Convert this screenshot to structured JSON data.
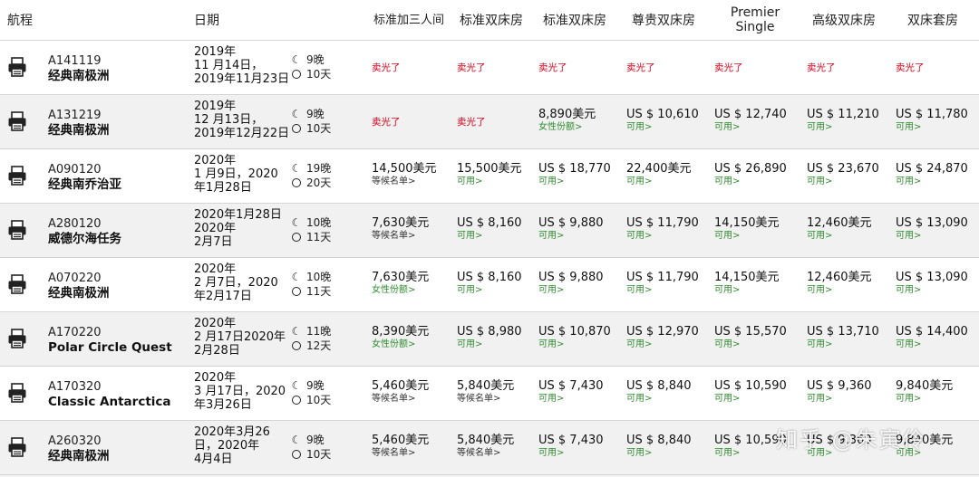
{
  "headers": {
    "route": "航程",
    "date": "日期",
    "cols": [
      "标准加三人间",
      "标准双床房",
      "标准双床房",
      "尊贵双床房",
      "Premier Single",
      "高级双床房",
      "双床套房"
    ]
  },
  "colors": {
    "sold": "#d0021b",
    "available": "#2e8b2e"
  },
  "icon": "printer-icon",
  "rows": [
    {
      "code": "A141119",
      "name": "经典南极洲",
      "date": [
        "2019年",
        "11 月14日，",
        "2019年11月23日"
      ],
      "nights": "9晚",
      "days": "10天",
      "prices": [
        {
          "price": "",
          "status": "卖光了",
          "type": "sold"
        },
        {
          "price": "",
          "status": "卖光了",
          "type": "sold"
        },
        {
          "price": "",
          "status": "卖光了",
          "type": "sold"
        },
        {
          "price": "",
          "status": "卖光了",
          "type": "sold"
        },
        {
          "price": "",
          "status": "卖光了",
          "type": "sold"
        },
        {
          "price": "",
          "status": "卖光了",
          "type": "sold"
        },
        {
          "price": "",
          "status": "卖光了",
          "type": "sold"
        }
      ]
    },
    {
      "code": "A131219",
      "name": "经典南极洲",
      "date": [
        "2019年",
        "12 月13日，",
        "2019年12月22日"
      ],
      "nights": "9晚",
      "days": "10天",
      "prices": [
        {
          "price": "",
          "status": "卖光了",
          "type": "sold"
        },
        {
          "price": "",
          "status": "卖光了",
          "type": "sold"
        },
        {
          "price": "8,890美元",
          "status": "女性份额>",
          "type": "avail"
        },
        {
          "price": "US $ 10,610",
          "status": "可用>",
          "type": "avail"
        },
        {
          "price": "US $ 12,740",
          "status": "可用>",
          "type": "avail"
        },
        {
          "price": "US $ 11,210",
          "status": "可用>",
          "type": "avail"
        },
        {
          "price": "US $ 11,780",
          "status": "可用>",
          "type": "avail"
        }
      ]
    },
    {
      "code": "A090120",
      "name": "经典南乔治亚",
      "date": [
        "2020年",
        "1 月9日，2020",
        "年1月28日"
      ],
      "nights": "19晚",
      "days": "20天",
      "prices": [
        {
          "price": "14,500美元",
          "status": "等候名单>",
          "type": "wait"
        },
        {
          "price": "15,500美元",
          "status": "可用>",
          "type": "avail"
        },
        {
          "price": "US $ 18,770",
          "status": "可用>",
          "type": "avail"
        },
        {
          "price": "22,400美元",
          "status": "可用>",
          "type": "avail"
        },
        {
          "price": "US $ 26,890",
          "status": "可用>",
          "type": "avail"
        },
        {
          "price": "US $ 23,670",
          "status": "可用>",
          "type": "avail"
        },
        {
          "price": "US $ 24,870",
          "status": "可用>",
          "type": "avail"
        }
      ]
    },
    {
      "code": "A280120",
      "name": "威德尔海任务",
      "date": [
        "2020年1月28日",
        "2020年",
        "2月7日"
      ],
      "nights": "10晚",
      "days": "11天",
      "prices": [
        {
          "price": "7,630美元",
          "status": "等候名单>",
          "type": "wait"
        },
        {
          "price": "US $ 8,160",
          "status": "可用>",
          "type": "avail"
        },
        {
          "price": "US $ 9,880",
          "status": "可用>",
          "type": "avail"
        },
        {
          "price": "US $ 11,790",
          "status": "可用>",
          "type": "avail"
        },
        {
          "price": "14,150美元",
          "status": "可用>",
          "type": "avail"
        },
        {
          "price": "12,460美元",
          "status": "可用>",
          "type": "avail"
        },
        {
          "price": "US $ 13,090",
          "status": "可用>",
          "type": "avail"
        }
      ]
    },
    {
      "code": "A070220",
      "name": "经典南极洲",
      "date": [
        "2020年",
        "2 月7日，2020",
        "年2月17日"
      ],
      "nights": "10晚",
      "days": "11天",
      "prices": [
        {
          "price": "7,630美元",
          "status": "女性份额>",
          "type": "avail"
        },
        {
          "price": "US $ 8,160",
          "status": "可用>",
          "type": "avail"
        },
        {
          "price": "US $ 9,880",
          "status": "可用>",
          "type": "avail"
        },
        {
          "price": "US $ 11,790",
          "status": "可用>",
          "type": "avail"
        },
        {
          "price": "14,150美元",
          "status": "可用>",
          "type": "avail"
        },
        {
          "price": "12,460美元",
          "status": "可用>",
          "type": "avail"
        },
        {
          "price": "US $ 13,090",
          "status": "可用>",
          "type": "avail"
        }
      ]
    },
    {
      "code": "A170220",
      "name": "Polar Circle Quest",
      "date": [
        "2020年",
        "2 月17日2020年",
        "2月28日"
      ],
      "nights": "11晚",
      "days": "12天",
      "prices": [
        {
          "price": "8,390美元",
          "status": "女性份额>",
          "type": "avail"
        },
        {
          "price": "US $ 8,980",
          "status": "可用>",
          "type": "avail"
        },
        {
          "price": "US $ 10,870",
          "status": "可用>",
          "type": "avail"
        },
        {
          "price": "US $ 12,970",
          "status": "可用>",
          "type": "avail"
        },
        {
          "price": "US $ 15,570",
          "status": "可用>",
          "type": "avail"
        },
        {
          "price": "US $ 13,710",
          "status": "可用>",
          "type": "avail"
        },
        {
          "price": "US $ 14,400",
          "status": "可用>",
          "type": "avail"
        }
      ]
    },
    {
      "code": "A170320",
      "name": "Classic Antarctica",
      "date": [
        "2020年",
        "3 月17日，2020",
        "年3月26日"
      ],
      "nights": "9晚",
      "days": "10天",
      "prices": [
        {
          "price": "5,460美元",
          "status": "等候名单>",
          "type": "wait"
        },
        {
          "price": "5,840美元",
          "status": "等候名单>",
          "type": "wait"
        },
        {
          "price": "US $ 7,430",
          "status": "可用>",
          "type": "avail"
        },
        {
          "price": "US $ 8,840",
          "status": "可用>",
          "type": "avail"
        },
        {
          "price": "US $ 10,590",
          "status": "可用>",
          "type": "avail"
        },
        {
          "price": "US $ 9,360",
          "status": "可用>",
          "type": "avail"
        },
        {
          "price": "9,840美元",
          "status": "可用>",
          "type": "avail"
        }
      ]
    },
    {
      "code": "A260320",
      "name": "经典南极洲",
      "date": [
        "2020年3月26",
        "日，2020年",
        "4月4日"
      ],
      "nights": "9晚",
      "days": "10天",
      "prices": [
        {
          "price": "5,460美元",
          "status": "等候名单>",
          "type": "wait"
        },
        {
          "price": "5,840美元",
          "status": "等候名单>",
          "type": "wait"
        },
        {
          "price": "US $ 7,430",
          "status": "可用>",
          "type": "avail"
        },
        {
          "price": "US $ 8,840",
          "status": "可用>",
          "type": "avail"
        },
        {
          "price": "US $ 10,590",
          "status": "可用>",
          "type": "avail"
        },
        {
          "price": "US $ 9,360",
          "status": "可用>",
          "type": "avail"
        },
        {
          "price": "9,840美元",
          "status": "可用>",
          "type": "avail"
        }
      ]
    }
  ],
  "watermark": "知乎 @朱寅伶"
}
